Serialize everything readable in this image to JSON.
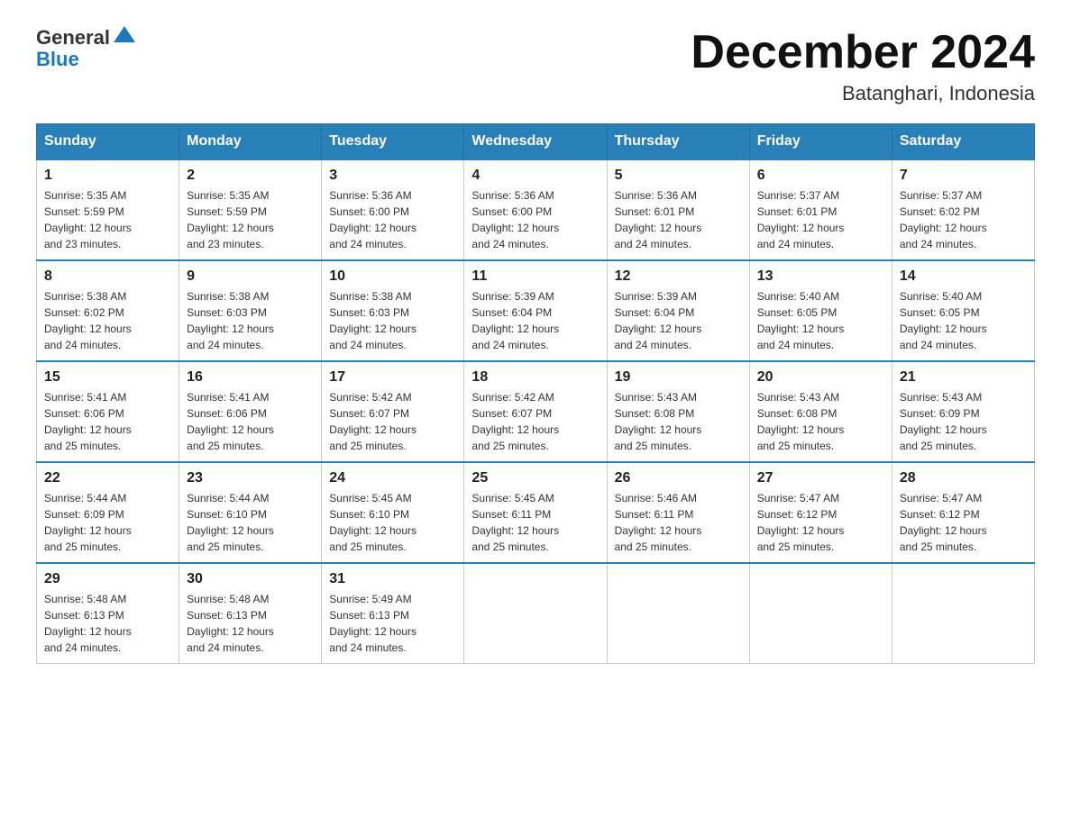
{
  "logo": {
    "text_general": "General",
    "text_blue": "Blue"
  },
  "header": {
    "title": "December 2024",
    "subtitle": "Batanghari, Indonesia"
  },
  "days_of_week": [
    "Sunday",
    "Monday",
    "Tuesday",
    "Wednesday",
    "Thursday",
    "Friday",
    "Saturday"
  ],
  "weeks": [
    [
      {
        "num": "1",
        "sunrise": "5:35 AM",
        "sunset": "5:59 PM",
        "daylight": "12 hours and 23 minutes."
      },
      {
        "num": "2",
        "sunrise": "5:35 AM",
        "sunset": "5:59 PM",
        "daylight": "12 hours and 23 minutes."
      },
      {
        "num": "3",
        "sunrise": "5:36 AM",
        "sunset": "6:00 PM",
        "daylight": "12 hours and 24 minutes."
      },
      {
        "num": "4",
        "sunrise": "5:36 AM",
        "sunset": "6:00 PM",
        "daylight": "12 hours and 24 minutes."
      },
      {
        "num": "5",
        "sunrise": "5:36 AM",
        "sunset": "6:01 PM",
        "daylight": "12 hours and 24 minutes."
      },
      {
        "num": "6",
        "sunrise": "5:37 AM",
        "sunset": "6:01 PM",
        "daylight": "12 hours and 24 minutes."
      },
      {
        "num": "7",
        "sunrise": "5:37 AM",
        "sunset": "6:02 PM",
        "daylight": "12 hours and 24 minutes."
      }
    ],
    [
      {
        "num": "8",
        "sunrise": "5:38 AM",
        "sunset": "6:02 PM",
        "daylight": "12 hours and 24 minutes."
      },
      {
        "num": "9",
        "sunrise": "5:38 AM",
        "sunset": "6:03 PM",
        "daylight": "12 hours and 24 minutes."
      },
      {
        "num": "10",
        "sunrise": "5:38 AM",
        "sunset": "6:03 PM",
        "daylight": "12 hours and 24 minutes."
      },
      {
        "num": "11",
        "sunrise": "5:39 AM",
        "sunset": "6:04 PM",
        "daylight": "12 hours and 24 minutes."
      },
      {
        "num": "12",
        "sunrise": "5:39 AM",
        "sunset": "6:04 PM",
        "daylight": "12 hours and 24 minutes."
      },
      {
        "num": "13",
        "sunrise": "5:40 AM",
        "sunset": "6:05 PM",
        "daylight": "12 hours and 24 minutes."
      },
      {
        "num": "14",
        "sunrise": "5:40 AM",
        "sunset": "6:05 PM",
        "daylight": "12 hours and 24 minutes."
      }
    ],
    [
      {
        "num": "15",
        "sunrise": "5:41 AM",
        "sunset": "6:06 PM",
        "daylight": "12 hours and 25 minutes."
      },
      {
        "num": "16",
        "sunrise": "5:41 AM",
        "sunset": "6:06 PM",
        "daylight": "12 hours and 25 minutes."
      },
      {
        "num": "17",
        "sunrise": "5:42 AM",
        "sunset": "6:07 PM",
        "daylight": "12 hours and 25 minutes."
      },
      {
        "num": "18",
        "sunrise": "5:42 AM",
        "sunset": "6:07 PM",
        "daylight": "12 hours and 25 minutes."
      },
      {
        "num": "19",
        "sunrise": "5:43 AM",
        "sunset": "6:08 PM",
        "daylight": "12 hours and 25 minutes."
      },
      {
        "num": "20",
        "sunrise": "5:43 AM",
        "sunset": "6:08 PM",
        "daylight": "12 hours and 25 minutes."
      },
      {
        "num": "21",
        "sunrise": "5:43 AM",
        "sunset": "6:09 PM",
        "daylight": "12 hours and 25 minutes."
      }
    ],
    [
      {
        "num": "22",
        "sunrise": "5:44 AM",
        "sunset": "6:09 PM",
        "daylight": "12 hours and 25 minutes."
      },
      {
        "num": "23",
        "sunrise": "5:44 AM",
        "sunset": "6:10 PM",
        "daylight": "12 hours and 25 minutes."
      },
      {
        "num": "24",
        "sunrise": "5:45 AM",
        "sunset": "6:10 PM",
        "daylight": "12 hours and 25 minutes."
      },
      {
        "num": "25",
        "sunrise": "5:45 AM",
        "sunset": "6:11 PM",
        "daylight": "12 hours and 25 minutes."
      },
      {
        "num": "26",
        "sunrise": "5:46 AM",
        "sunset": "6:11 PM",
        "daylight": "12 hours and 25 minutes."
      },
      {
        "num": "27",
        "sunrise": "5:47 AM",
        "sunset": "6:12 PM",
        "daylight": "12 hours and 25 minutes."
      },
      {
        "num": "28",
        "sunrise": "5:47 AM",
        "sunset": "6:12 PM",
        "daylight": "12 hours and 25 minutes."
      }
    ],
    [
      {
        "num": "29",
        "sunrise": "5:48 AM",
        "sunset": "6:13 PM",
        "daylight": "12 hours and 24 minutes."
      },
      {
        "num": "30",
        "sunrise": "5:48 AM",
        "sunset": "6:13 PM",
        "daylight": "12 hours and 24 minutes."
      },
      {
        "num": "31",
        "sunrise": "5:49 AM",
        "sunset": "6:13 PM",
        "daylight": "12 hours and 24 minutes."
      },
      null,
      null,
      null,
      null
    ]
  ],
  "labels": {
    "sunrise": "Sunrise:",
    "sunset": "Sunset:",
    "daylight": "Daylight:"
  }
}
